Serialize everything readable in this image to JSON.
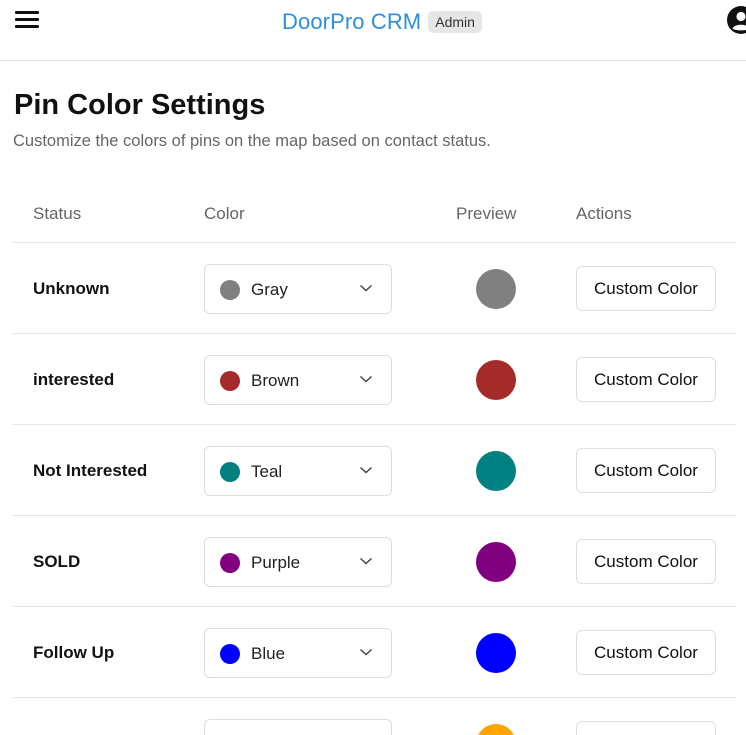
{
  "header": {
    "brand": "DoorPro CRM",
    "badge": "Admin"
  },
  "page": {
    "title": "Pin Color Settings",
    "subtitle": "Customize the colors of pins on the map based on contact status."
  },
  "table": {
    "columns": [
      "Status",
      "Color",
      "Preview",
      "Actions"
    ],
    "rows": [
      {
        "status": "Unknown",
        "color_name": "Gray",
        "color_hex": "#808080",
        "action": "Custom Color"
      },
      {
        "status": "interested",
        "color_name": "Brown",
        "color_hex": "#a52a2a",
        "action": "Custom Color"
      },
      {
        "status": "Not Interested",
        "color_name": "Teal",
        "color_hex": "#008080",
        "action": "Custom Color"
      },
      {
        "status": "SOLD",
        "color_name": "Purple",
        "color_hex": "#800080",
        "action": "Custom Color"
      },
      {
        "status": "Follow Up",
        "color_name": "Blue",
        "color_hex": "#0000ff",
        "action": "Custom Color"
      },
      {
        "status": "",
        "color_name": "",
        "color_hex": "#ffa500",
        "action": ""
      }
    ]
  },
  "icons": {
    "menu": "hamburger-menu-icon",
    "user": "user-circle-icon",
    "dropdown": "chevron-down-icon"
  }
}
